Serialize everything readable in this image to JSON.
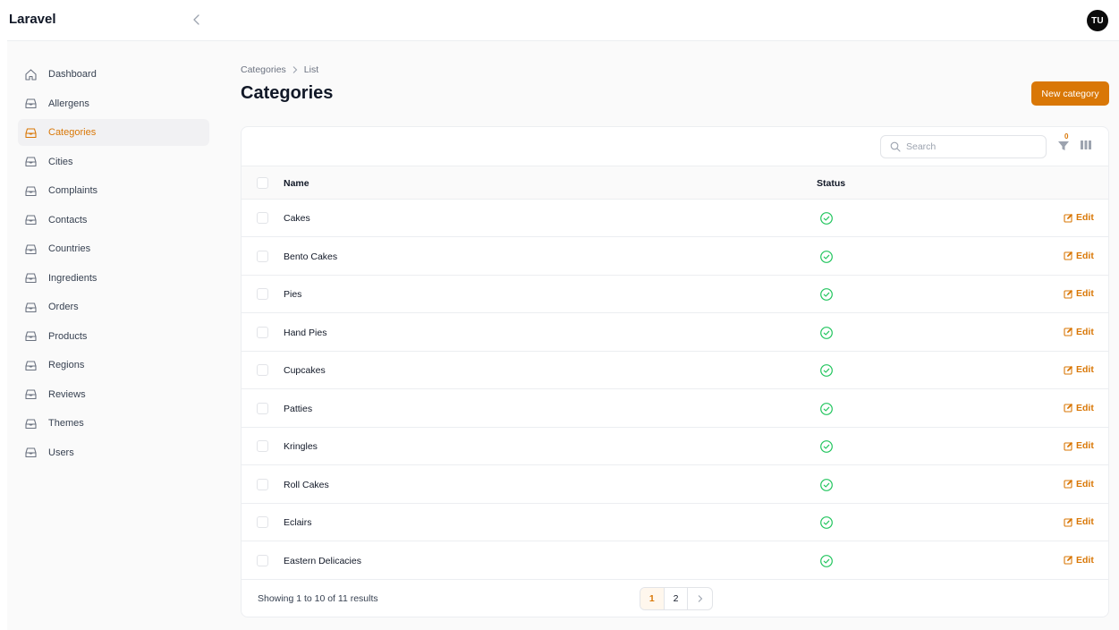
{
  "app": {
    "brand": "Laravel",
    "avatar_initials": "TU",
    "accent_color": "#d97706"
  },
  "sidebar": {
    "items": [
      {
        "label": "Dashboard",
        "icon": "home-icon"
      },
      {
        "label": "Allergens",
        "icon": "tray-icon"
      },
      {
        "label": "Categories",
        "icon": "tray-icon",
        "active": true
      },
      {
        "label": "Cities",
        "icon": "tray-icon"
      },
      {
        "label": "Complaints",
        "icon": "tray-icon"
      },
      {
        "label": "Contacts",
        "icon": "tray-icon"
      },
      {
        "label": "Countries",
        "icon": "tray-icon"
      },
      {
        "label": "Ingredients",
        "icon": "tray-icon"
      },
      {
        "label": "Orders",
        "icon": "tray-icon"
      },
      {
        "label": "Products",
        "icon": "tray-icon"
      },
      {
        "label": "Regions",
        "icon": "tray-icon"
      },
      {
        "label": "Reviews",
        "icon": "tray-icon"
      },
      {
        "label": "Themes",
        "icon": "tray-icon"
      },
      {
        "label": "Users",
        "icon": "tray-icon"
      }
    ]
  },
  "header": {
    "breadcrumb": [
      "Categories",
      "List"
    ],
    "title": "Categories",
    "new_button": "New category"
  },
  "table": {
    "search_placeholder": "Search",
    "filter_count": "0",
    "columns": [
      "Name",
      "Status"
    ],
    "rows": [
      {
        "name": "Cakes",
        "status": "active"
      },
      {
        "name": "Bento Cakes",
        "status": "active"
      },
      {
        "name": "Pies",
        "status": "active"
      },
      {
        "name": "Hand Pies",
        "status": "active"
      },
      {
        "name": "Cupcakes",
        "status": "active"
      },
      {
        "name": "Patties",
        "status": "active"
      },
      {
        "name": "Kringles",
        "status": "active"
      },
      {
        "name": "Roll Cakes",
        "status": "active"
      },
      {
        "name": "Eclairs",
        "status": "active"
      },
      {
        "name": "Eastern Delicacies",
        "status": "active"
      }
    ],
    "edit_label": "Edit",
    "showing": "Showing 1 to 10 of 11 results",
    "pages": [
      "1",
      "2"
    ],
    "current_page": "1"
  }
}
